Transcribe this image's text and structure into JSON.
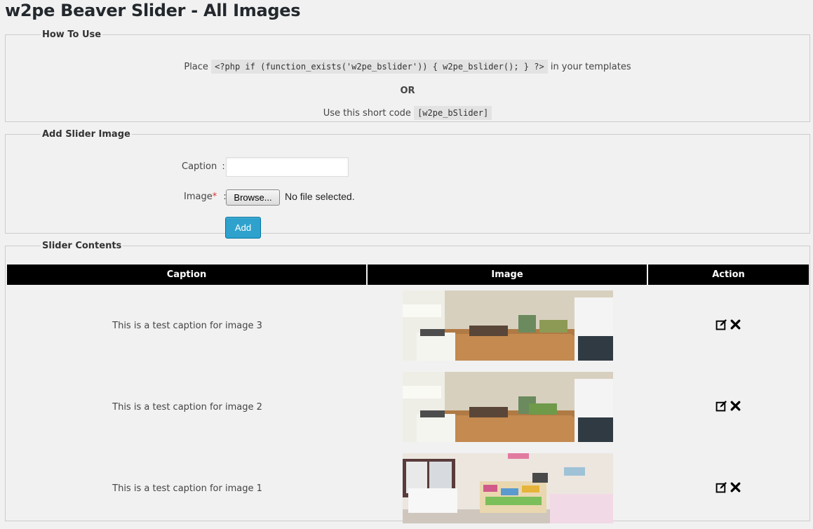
{
  "page": {
    "title": "w2pe Beaver Slider - All Images"
  },
  "how_to_use": {
    "legend": "How To Use",
    "line1_prefix": "Place",
    "php_code": "<?php if (function_exists('w2pe_bslider')) { w2pe_bslider(); } ?>",
    "line1_suffix": "in your templates",
    "or_text": "OR",
    "line3_prefix": "Use this short code",
    "shortcode": "[w2pe_bSlider]"
  },
  "add_form": {
    "legend": "Add Slider Image",
    "caption_label": "Caption",
    "caption_value": "",
    "image_label": "Image",
    "required_mark": "*",
    "colon": ":",
    "browse_label": "Browse...",
    "file_status": "No file selected.",
    "add_button": "Add"
  },
  "slider_contents": {
    "legend": "Slider Contents",
    "columns": [
      "Caption",
      "Image",
      "Action"
    ],
    "rows": [
      {
        "caption": "This is a test caption for image 3",
        "image": "kitchen-living-room-photo"
      },
      {
        "caption": "This is a test caption for image 2",
        "image": "kitchen-living-room-photo"
      },
      {
        "caption": "This is a test caption for image 1",
        "image": "playroom-photo"
      }
    ]
  },
  "icons": {
    "edit": "edit-icon",
    "delete": "delete-icon"
  },
  "colors": {
    "accent": "#2ea2cc",
    "header_bg": "#000000",
    "page_bg": "#f1f1f1",
    "required": "#dc3232"
  }
}
